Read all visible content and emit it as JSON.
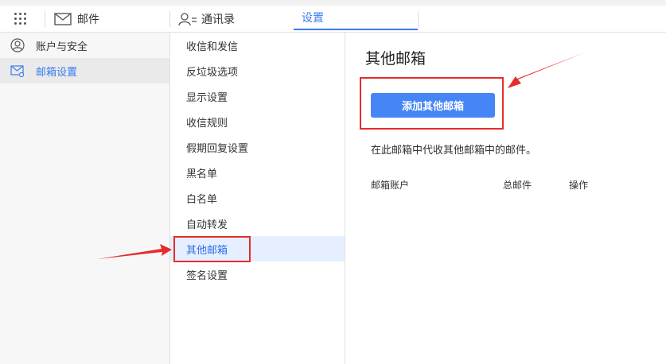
{
  "topbar": {
    "mail_label": "邮件",
    "contacts_label": "通讯录",
    "settings_label": "设置"
  },
  "leftnav": {
    "items": [
      {
        "label": "账户与安全",
        "icon": "user-icon"
      },
      {
        "label": "邮箱设置",
        "icon": "mail-settings-icon"
      }
    ]
  },
  "subnav": {
    "items": [
      {
        "label": "收信和发信"
      },
      {
        "label": "反垃圾选项"
      },
      {
        "label": "显示设置"
      },
      {
        "label": "收信规则"
      },
      {
        "label": "假期回复设置"
      },
      {
        "label": "黑名单"
      },
      {
        "label": "白名单"
      },
      {
        "label": "自动转发"
      },
      {
        "label": "其他邮箱"
      },
      {
        "label": "签名设置"
      }
    ]
  },
  "main": {
    "title": "其他邮箱",
    "add_button": "添加其他邮箱",
    "description": "在此邮箱中代收其他邮箱中的邮件。",
    "table_headers": [
      "邮箱账户",
      "总邮件",
      "操作"
    ]
  },
  "colors": {
    "accent": "#3b7cf0",
    "button": "#4585f5",
    "highlight": "#e52c2c"
  }
}
